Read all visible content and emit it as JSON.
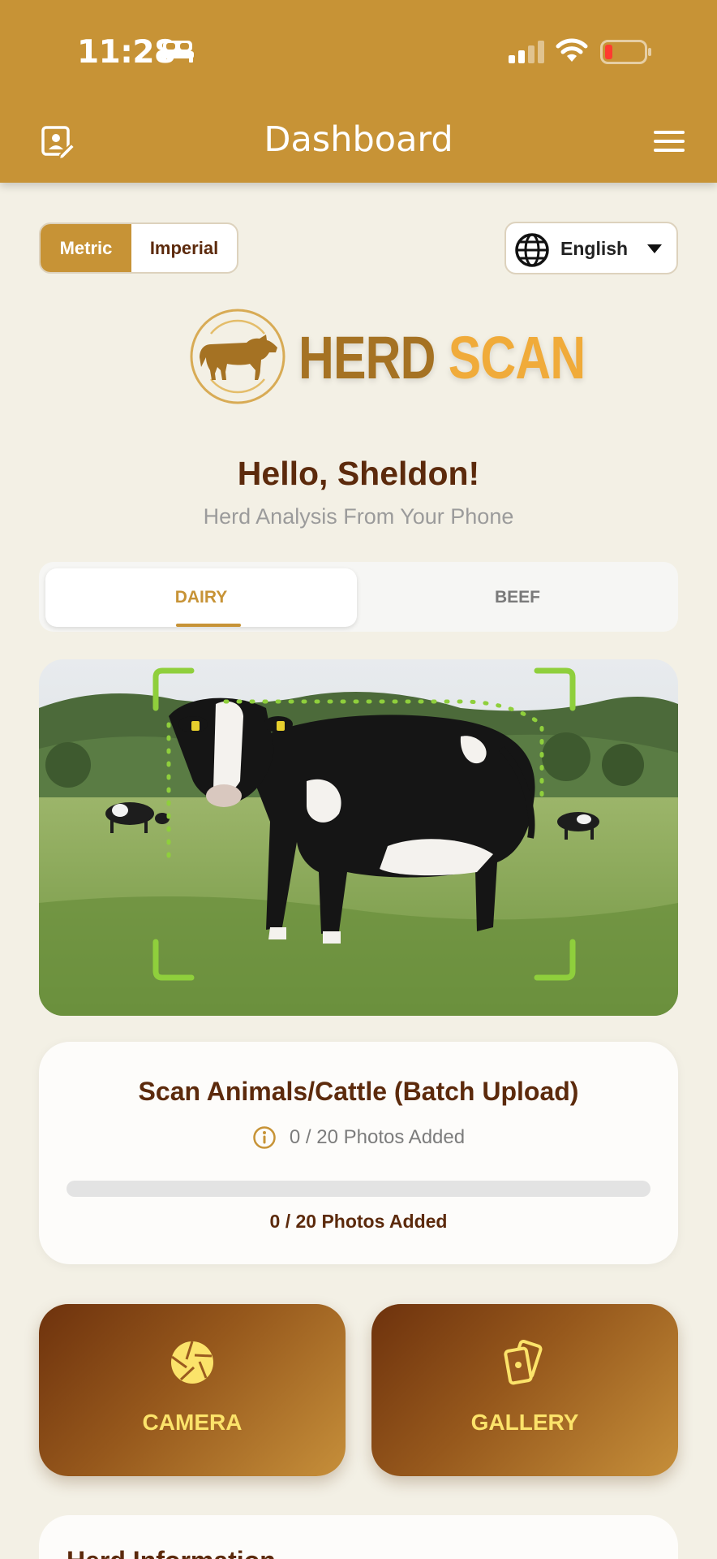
{
  "status_bar": {
    "time": "11:28",
    "battery_level": 0.15
  },
  "header": {
    "title": "Dashboard"
  },
  "units": {
    "options": [
      "Metric",
      "Imperial"
    ],
    "selected": "Metric"
  },
  "language": {
    "selected": "English"
  },
  "logo": {
    "part1": "HERD",
    "part2": "SCAN"
  },
  "greeting": {
    "title": "Hello, Sheldon!",
    "subtitle": "Herd Analysis From Your Phone"
  },
  "animal_type_tabs": {
    "items": [
      "DAIRY",
      "BEEF"
    ],
    "selected": "DAIRY"
  },
  "scan_card": {
    "title": "Scan Animals/Cattle (Batch Upload)",
    "info_text": "0 / 20 Photos Added",
    "progress_label": "0 / 20 Photos Added",
    "photos_added": 0,
    "photos_max": 20
  },
  "actions": {
    "camera_label": "CAMERA",
    "gallery_label": "GALLERY"
  },
  "herd_info": {
    "title": "Herd Information"
  },
  "colors": {
    "header": "#c79336",
    "background": "#f3f0e5",
    "brown_text": "#5c2a0c",
    "accent": "#c79336",
    "button_label": "#fbe36a",
    "scan_frame": "#8fcf3c"
  }
}
